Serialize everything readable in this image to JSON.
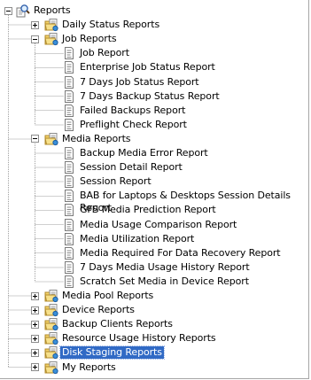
{
  "tree": {
    "root": {
      "label": "Reports",
      "expanded": true,
      "icon": "magnifier-icon"
    },
    "groups": [
      {
        "label": "Daily Status Reports",
        "expanded": false,
        "icon": "report-folder-icon",
        "children": []
      },
      {
        "label": "Job Reports",
        "expanded": true,
        "icon": "report-folder-icon",
        "children": [
          {
            "label": "Job Report",
            "icon": "report-document-icon"
          },
          {
            "label": "Enterprise Job Status Report",
            "icon": "report-document-icon"
          },
          {
            "label": "7 Days Job Status Report",
            "icon": "report-document-icon"
          },
          {
            "label": "7 Days Backup Status Report",
            "icon": "report-document-icon"
          },
          {
            "label": "Failed Backups Report",
            "icon": "report-document-icon"
          },
          {
            "label": "Preflight Check Report",
            "icon": "report-document-icon"
          }
        ]
      },
      {
        "label": "Media Reports",
        "expanded": true,
        "icon": "report-folder-icon",
        "children": [
          {
            "label": "Backup Media Error Report",
            "icon": "report-document-icon"
          },
          {
            "label": "Session Detail Report",
            "icon": "report-document-icon"
          },
          {
            "label": "Session Report",
            "icon": "report-document-icon"
          },
          {
            "label": "BAB for Laptops & Desktops Session Details Report",
            "icon": "report-document-icon"
          },
          {
            "label": "GFS Media Prediction Report",
            "icon": "report-document-icon"
          },
          {
            "label": "Media Usage Comparison Report",
            "icon": "report-document-icon"
          },
          {
            "label": "Media Utilization Report",
            "icon": "report-document-icon"
          },
          {
            "label": "Media Required For Data Recovery Report",
            "icon": "report-document-icon"
          },
          {
            "label": "7 Days Media Usage History Report",
            "icon": "report-document-icon"
          },
          {
            "label": "Scratch Set Media in Device Report",
            "icon": "report-document-icon"
          }
        ]
      },
      {
        "label": "Media Pool Reports",
        "expanded": false,
        "icon": "report-folder-icon",
        "children": []
      },
      {
        "label": "Device Reports",
        "expanded": false,
        "icon": "report-folder-icon",
        "children": []
      },
      {
        "label": "Backup Clients Reports",
        "expanded": false,
        "icon": "report-folder-icon",
        "children": []
      },
      {
        "label": "Resource Usage History Reports",
        "expanded": false,
        "icon": "report-folder-icon",
        "children": []
      },
      {
        "label": "Disk Staging Reports",
        "expanded": false,
        "selected": true,
        "icon": "report-folder-icon",
        "children": []
      },
      {
        "label": "My Reports",
        "expanded": false,
        "icon": "report-folder-icon",
        "children": []
      }
    ]
  },
  "colors": {
    "selection_bg": "#316ac5",
    "selection_text": "#ffffff",
    "tree_line": "#a0a0a0",
    "folder_yellow": "#f3d36b",
    "document_paper": "#ffffff"
  }
}
